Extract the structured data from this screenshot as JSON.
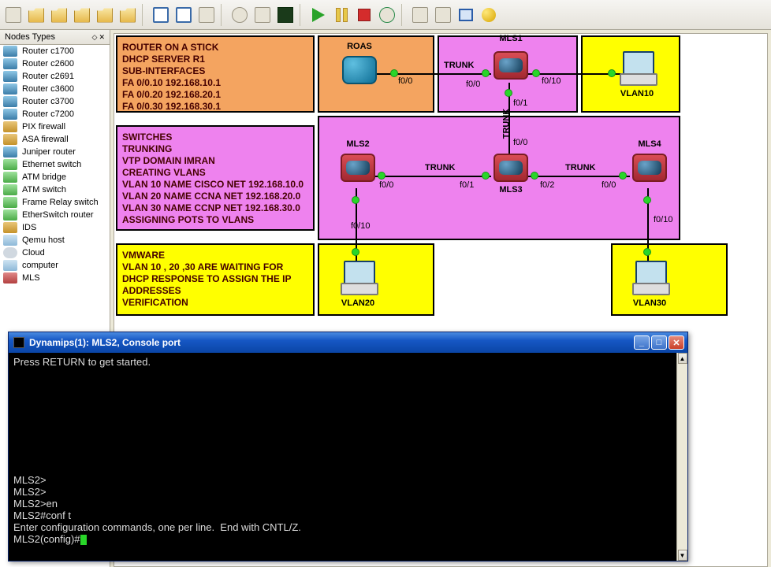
{
  "sidebar": {
    "title": "Nodes Types",
    "items": [
      {
        "label": "Router c1700",
        "ic": "ni-router"
      },
      {
        "label": "Router c2600",
        "ic": "ni-router"
      },
      {
        "label": "Router c2691",
        "ic": "ni-router"
      },
      {
        "label": "Router c3600",
        "ic": "ni-router"
      },
      {
        "label": "Router c3700",
        "ic": "ni-router"
      },
      {
        "label": "Router c7200",
        "ic": "ni-router"
      },
      {
        "label": "PIX firewall",
        "ic": "ni-fw"
      },
      {
        "label": "ASA firewall",
        "ic": "ni-fw"
      },
      {
        "label": "Juniper router",
        "ic": "ni-router"
      },
      {
        "label": "Ethernet switch",
        "ic": "ni-sw"
      },
      {
        "label": "ATM bridge",
        "ic": "ni-sw"
      },
      {
        "label": "ATM switch",
        "ic": "ni-sw"
      },
      {
        "label": "Frame Relay switch",
        "ic": "ni-sw"
      },
      {
        "label": "EtherSwitch router",
        "ic": "ni-sw"
      },
      {
        "label": "IDS",
        "ic": "ni-fw"
      },
      {
        "label": "Qemu host",
        "ic": "ni-pc"
      },
      {
        "label": "Cloud",
        "ic": "ni-cloud"
      },
      {
        "label": "computer",
        "ic": "ni-pc"
      },
      {
        "label": "MLS",
        "ic": "ni-mls"
      }
    ]
  },
  "notes": {
    "n1": {
      "l1": "ROUTER ON A STICK",
      "l2": "DHCP SERVER R1",
      "l3": "SUB-INTERFACES",
      "l4": "FA 0/0.10 192.168.10.1",
      "l5": "FA 0/0.20 192.168.20.1",
      "l6": "FA 0/0.30 192.168.30.1"
    },
    "n2": {
      "l1": "SWITCHES",
      "l2": "TRUNKING",
      "l3": "VTP DOMAIN IMRAN",
      "l4": "CREATING VLANS",
      "l5": "VLAN 10 NAME CISCO NET 192.168.10.0",
      "l6": "VLAN 20 NAME CCNA NET 192.168.20.0",
      "l7": "VLAN 30 NAME CCNP NET 192.168.30.0",
      "l8": "ASSIGNING POTS TO VLANS"
    },
    "n3": {
      "l1": "VMWARE",
      "l2": "VLAN 10 , 20 ,30 ARE WAITING FOR",
      "l3": "DHCP RESPONSE TO ASSIGN THE IP",
      "l4": "ADDRESSES",
      "l5": "VERIFICATION"
    }
  },
  "devices": {
    "roas": "ROAS",
    "mls1": "MLS1",
    "mls2": "MLS2",
    "mls3": "MLS3",
    "mls4": "MLS4",
    "vlan10": "VLAN10",
    "vlan20": "VLAN20",
    "vlan30": "VLAN30"
  },
  "ports": {
    "p1": "f0/0",
    "p2": "f0/0",
    "p3": "f0/10",
    "p4": "f0/1",
    "p5": "f0/0",
    "p6": "f0/0",
    "p7": "f0/1",
    "p8": "f0/2",
    "p9": "f0/0",
    "p10": "f0/10",
    "p11": "f0/10"
  },
  "linklabels": {
    "t1": "TRUNK",
    "t2": "TRUNK",
    "t3": "TRUNK",
    "t4": "TRUNK"
  },
  "console": {
    "title": "Dynamips(1): MLS2, Console port",
    "lines": [
      "Press RETURN to get started.",
      "",
      "",
      "",
      "",
      "",
      "",
      "",
      "",
      "",
      "MLS2>",
      "MLS2>",
      "MLS2>en",
      "MLS2#conf t",
      "Enter configuration commands, one per line.  End with CNTL/Z.",
      "MLS2(config)#"
    ]
  }
}
